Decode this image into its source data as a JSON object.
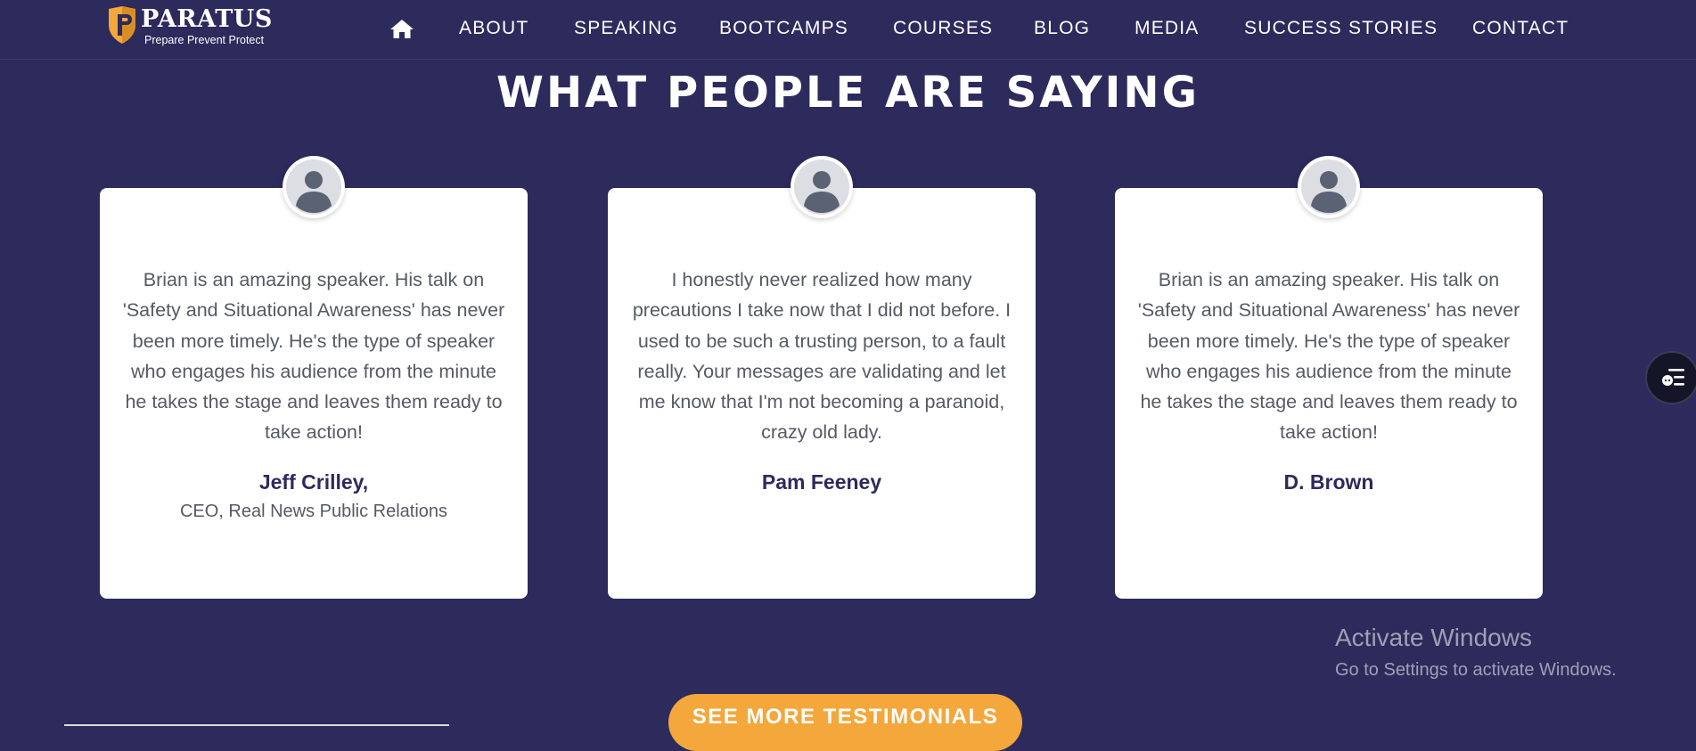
{
  "brand": {
    "name": "PARATUS",
    "tagline": "Prepare Prevent Protect",
    "colors": {
      "background": "#2d2a5c",
      "accent": "#f4a73a",
      "card": "#ffffff",
      "author": "#2d2a5c"
    }
  },
  "nav": {
    "home_icon": "home-icon",
    "links": [
      "ABOUT",
      "SPEAKING",
      "BOOTCAMPS",
      "COURSES",
      "BLOG",
      "MEDIA",
      "SUCCESS STORIES",
      "CONTACT"
    ]
  },
  "section": {
    "heading": "WHAT PEOPLE ARE SAYING"
  },
  "testimonials": [
    {
      "avatar_icon": "user-avatar-icon",
      "quote": "Brian is an amazing speaker. His talk on 'Safety and Situational Awareness' has never been more timely. He's the type of speaker who engages his audience from the minute he takes the stage and leaves them ready to take action!",
      "author": "Jeff Crilley,",
      "role": "CEO, Real News Public Relations"
    },
    {
      "avatar_icon": "user-avatar-icon",
      "quote": "I honestly never realized how many precautions I take now that I did not before. I used to be such a trusting person, to a fault really. Your messages are validating and let me know that I'm not becoming a paranoid, crazy old lady.",
      "author": "Pam Feeney",
      "role": ""
    },
    {
      "avatar_icon": "user-avatar-icon",
      "quote": "Brian is an amazing speaker. His talk on 'Safety and Situational Awareness' has never been more timely. He's the type of speaker who engages his audience from the minute he takes the stage and leaves them ready to take action!",
      "author": "D. Brown",
      "role": ""
    }
  ],
  "cta": {
    "label": "SEE MORE TESTIMONIALS"
  },
  "chat_widget": {
    "icon": "chat-menu-icon"
  },
  "windows_watermark": {
    "title": "Activate Windows",
    "subtitle": "Go to Settings to activate Windows."
  }
}
